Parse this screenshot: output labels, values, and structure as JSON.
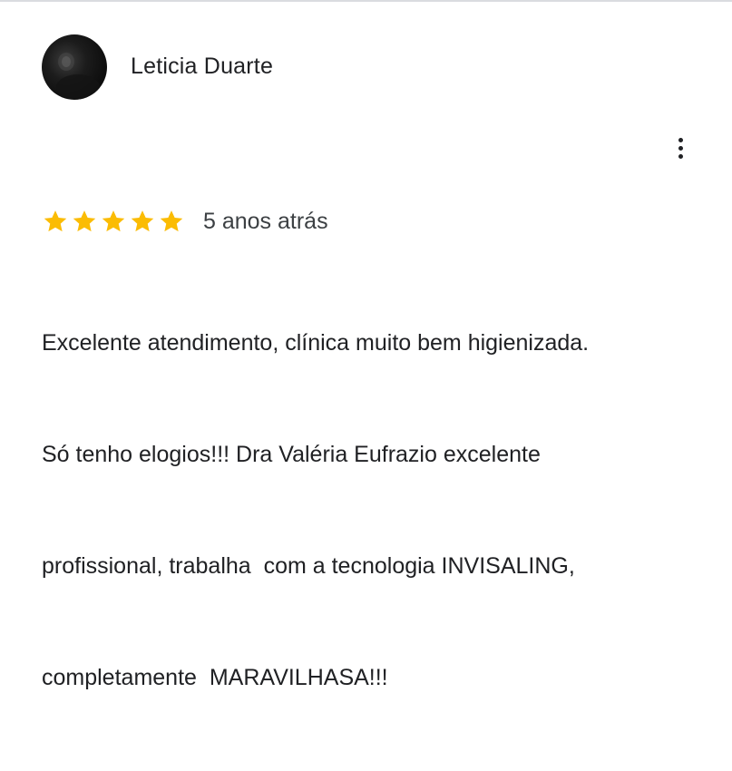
{
  "review": {
    "author_name": "Leticia Duarte",
    "rating": 5,
    "rating_max": 5,
    "date": "5 anos atrás",
    "text_lines": [
      "Excelente atendimento, clínica muito bem higienizada.",
      "Só tenho elogios!!! Dra Valéria Eufrazio excelente",
      "profissional, trabalha  com a tecnologia INVISALING,",
      "completamente  MARAVILHASA!!!"
    ]
  },
  "icons": {
    "avatar": "avatar-photo",
    "more": "more-vert-icon",
    "star": "star-icon"
  },
  "colors": {
    "star": "#fbbc04",
    "text": "#202124",
    "secondary_text": "#3c4043",
    "divider": "#dadce0"
  }
}
